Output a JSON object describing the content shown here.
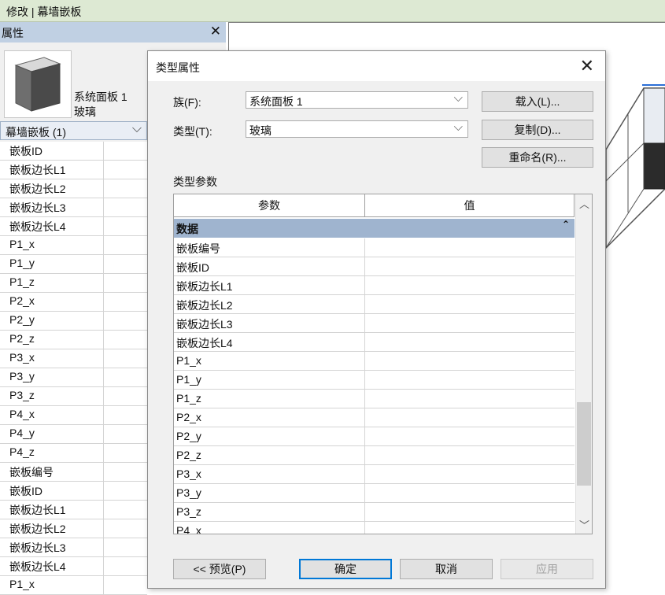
{
  "topbar": {
    "title": "修改 | 幕墙嵌板"
  },
  "properties": {
    "header": "属性",
    "close": "✕",
    "type_name_line1": "系统面板 1",
    "type_name_line2": "玻璃",
    "category": "幕墙嵌板 (1)",
    "rows": [
      "嵌板ID",
      "嵌板边长L1",
      "嵌板边长L2",
      "嵌板边长L3",
      "嵌板边长L4",
      "P1_x",
      "P1_y",
      "P1_z",
      "P2_x",
      "P2_y",
      "P2_z",
      "P3_x",
      "P3_y",
      "P3_z",
      "P4_x",
      "P4_y",
      "P4_z",
      "嵌板编号",
      "嵌板ID",
      "嵌板边长L1",
      "嵌板边长L2",
      "嵌板边长L3",
      "嵌板边长L4",
      "P1_x"
    ]
  },
  "dialog": {
    "title": "类型属性",
    "close": "✕",
    "family_label": "族(F):",
    "family_value": "系统面板 1",
    "type_label": "类型(T):",
    "type_value": "玻璃",
    "load_button": "载入(L)...",
    "duplicate_button": "复制(D)...",
    "rename_button": "重命名(R)...",
    "section_label": "类型参数",
    "col_param": "参数",
    "col_value": "值",
    "group": "数据",
    "params": [
      "嵌板编号",
      "嵌板ID",
      "嵌板边长L1",
      "嵌板边长L2",
      "嵌板边长L3",
      "嵌板边长L4",
      "P1_x",
      "P1_y",
      "P1_z",
      "P2_x",
      "P2_y",
      "P2_z",
      "P3_x",
      "P3_y",
      "P3_z",
      "P4_x"
    ],
    "preview_button": "<< 预览(P)",
    "ok_button": "确定",
    "cancel_button": "取消",
    "apply_button": "应用"
  },
  "colors": {
    "accent": "#0078d7",
    "group_row": "#9fb4cf",
    "header_bar": "#c0d0e3",
    "ribbon": "#dde9d3"
  }
}
